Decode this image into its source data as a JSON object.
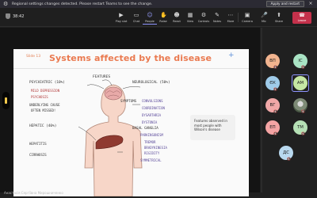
{
  "notification": {
    "message": "Regional settings changes detected. Please restart Teams to see the change.",
    "apply_label": "Apply and restart",
    "close_icon": "×"
  },
  "toolbar": {
    "timer": "38:42",
    "buttons": [
      {
        "label": "Play slot",
        "icon": "▶"
      },
      {
        "label": "Chat",
        "icon": "▭"
      },
      {
        "label": "People",
        "icon": "☺"
      },
      {
        "label": "Raise",
        "icon": "✋"
      },
      {
        "label": "React",
        "icon": "☻"
      },
      {
        "label": "View",
        "icon": "▦"
      },
      {
        "label": "Controls",
        "icon": "⚙"
      },
      {
        "label": "Notes",
        "icon": "✎"
      },
      {
        "label": "More",
        "icon": "⋯"
      },
      {
        "label": "Camera",
        "icon": "▣"
      },
      {
        "label": "Mic",
        "icon": "🎤"
      },
      {
        "label": "Share",
        "icon": "⬆"
      }
    ],
    "leave_label": "Leave",
    "leave_icon": "☎"
  },
  "slide": {
    "number": "Slide 13",
    "title": "Systems affected by the disease",
    "plus": "+",
    "note": [
      "Features observed in",
      "most people with",
      "Wilson's disease"
    ],
    "labels": {
      "features": "FEATURES",
      "psychiatric": "PSYCHIATRIC (10%)",
      "depression": "MILD DEPRESSION",
      "psychosis": "PSYCHOSIS",
      "underlying": "UNDERLYING CAUSE",
      "missed": "OFTEN MISSED!",
      "hepatic": "HEPATIC (40%)",
      "hepatitis": "HEPATITIS",
      "cirrhosis": "CIRRHOSIS",
      "neurological": "NEUROLOGICAL (50%)",
      "symptoms": "SYMPTOMS",
      "convulsions": "CONVULSIONS",
      "coordination": "COORDINATION",
      "dysarthria": "DYSARTHRIA",
      "dystonia": "DYSTONIA",
      "basal": "BASAL GANGLIA",
      "parkinsonism": "PARKINSONISM",
      "tremor": "TREMOR",
      "bradykinesia": "BRADYKINESIA",
      "rigidity": "RIGIDITY",
      "symmetrical": "SYMMETRICAL"
    }
  },
  "presenter": "Анастасія Сергіївна Мирошниченко",
  "participants": [
    {
      "initials": "ВП",
      "color": "#f2b48f"
    },
    {
      "initials": "ІС",
      "color": "#a9e3c4"
    },
    {
      "initials": "ЄК",
      "color": "#9fcbe9"
    },
    {
      "initials": "АМ",
      "color": "#c6e7a4"
    },
    {
      "initials": "ВГ",
      "color": "#f0a7a7"
    },
    {
      "initials": "",
      "color": "#7d8a76"
    },
    {
      "initials": "ЕП",
      "color": "#f4a4a4"
    },
    {
      "initials": "ТМ",
      "color": "#b5e0b5"
    },
    {
      "initials": "ДС",
      "color": "#b9d9ef"
    }
  ],
  "colors": {
    "accent": "#8f95ff",
    "leave": "#c4314b",
    "title": "#ea7a50"
  }
}
